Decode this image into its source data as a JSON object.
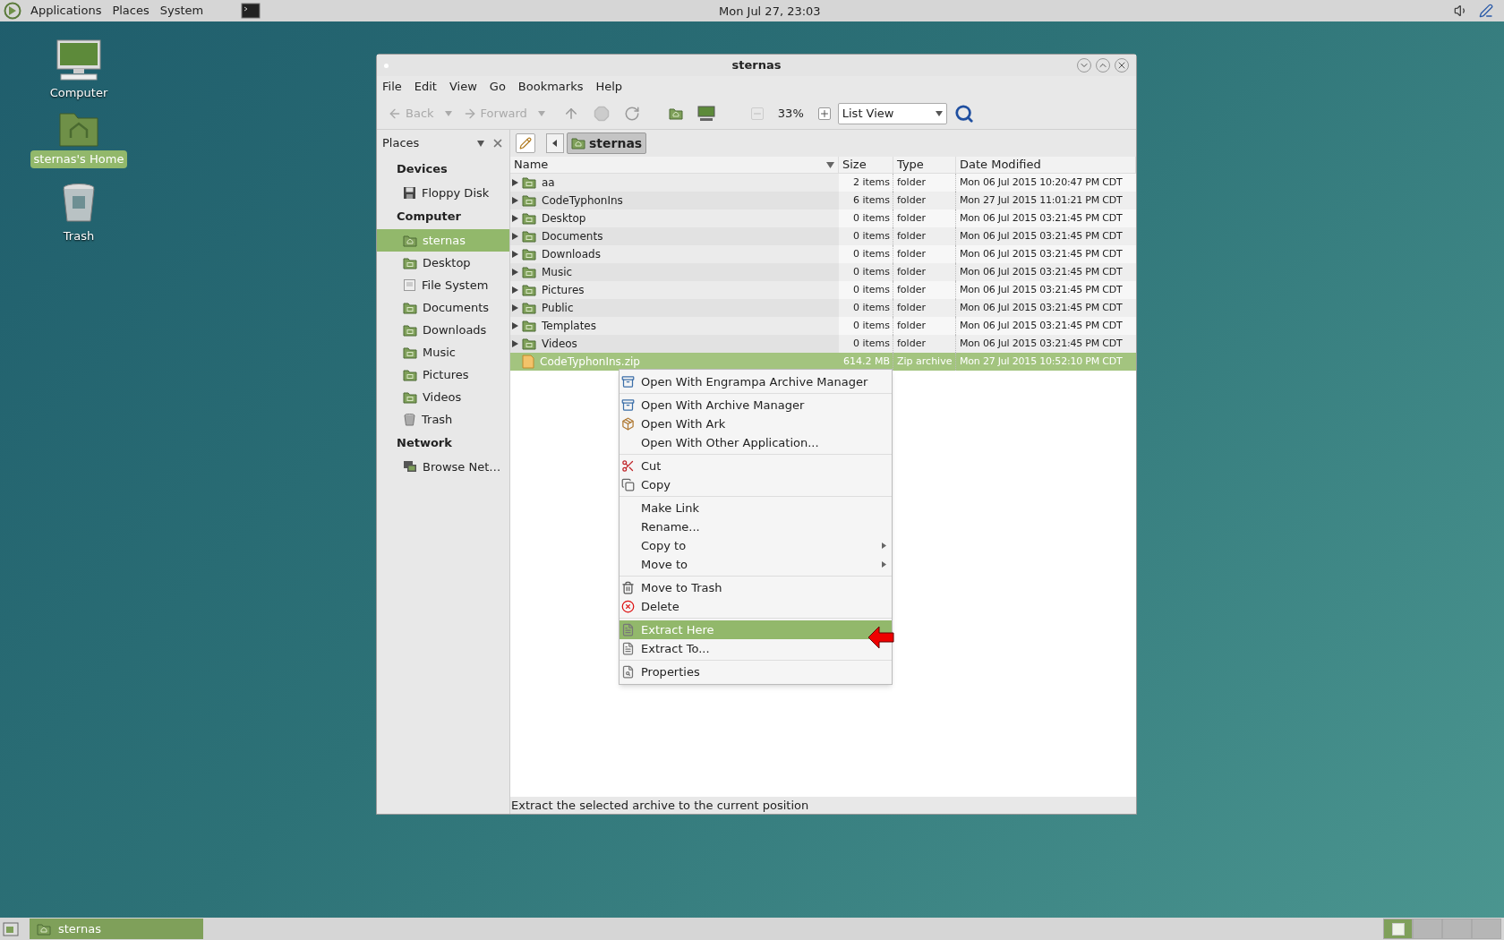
{
  "top_panel": {
    "menus": [
      "Applications",
      "Places",
      "System"
    ],
    "clock": "Mon Jul 27, 23:03"
  },
  "desktop_icons": [
    {
      "label": "Computer",
      "kind": "computer",
      "selected": false
    },
    {
      "label": "sternas's Home",
      "kind": "home",
      "selected": true
    },
    {
      "label": "Trash",
      "kind": "trash",
      "selected": false
    }
  ],
  "window": {
    "title": "sternas",
    "menu": [
      "File",
      "Edit",
      "View",
      "Go",
      "Bookmarks",
      "Help"
    ],
    "toolbar": {
      "back": {
        "label": "Back",
        "disabled": true
      },
      "forward": {
        "label": "Forward",
        "disabled": true
      },
      "zoom": "33%",
      "view": "List View"
    },
    "sidebar": {
      "title": "Places",
      "sections": [
        {
          "heading": "Devices",
          "items": [
            {
              "label": "Floppy Disk",
              "kind": "floppy",
              "selected": false
            }
          ]
        },
        {
          "heading": "Computer",
          "items": [
            {
              "label": "sternas",
              "kind": "home",
              "selected": true
            },
            {
              "label": "Desktop",
              "kind": "folder",
              "selected": false
            },
            {
              "label": "File System",
              "kind": "drive",
              "selected": false
            },
            {
              "label": "Documents",
              "kind": "folder",
              "selected": false
            },
            {
              "label": "Downloads",
              "kind": "folder",
              "selected": false
            },
            {
              "label": "Music",
              "kind": "folder",
              "selected": false
            },
            {
              "label": "Pictures",
              "kind": "folder",
              "selected": false
            },
            {
              "label": "Videos",
              "kind": "folder",
              "selected": false
            },
            {
              "label": "Trash",
              "kind": "trash",
              "selected": false
            }
          ]
        },
        {
          "heading": "Network",
          "items": [
            {
              "label": "Browse Net…",
              "kind": "network",
              "selected": false
            }
          ]
        }
      ]
    },
    "path": "sternas",
    "columns": [
      "Name",
      "Size",
      "Type",
      "Date Modified"
    ],
    "rows": [
      {
        "name": "aa",
        "size": "2 items",
        "type": "folder",
        "date": "Mon 06 Jul 2015 10:20:47 PM CDT",
        "kind": "folder",
        "selected": false
      },
      {
        "name": "CodeTyphonIns",
        "size": "6 items",
        "type": "folder",
        "date": "Mon 27 Jul 2015 11:01:21 PM CDT",
        "kind": "folder",
        "selected": false
      },
      {
        "name": "Desktop",
        "size": "0 items",
        "type": "folder",
        "date": "Mon 06 Jul 2015 03:21:45 PM CDT",
        "kind": "folder",
        "selected": false
      },
      {
        "name": "Documents",
        "size": "0 items",
        "type": "folder",
        "date": "Mon 06 Jul 2015 03:21:45 PM CDT",
        "kind": "folder",
        "selected": false
      },
      {
        "name": "Downloads",
        "size": "0 items",
        "type": "folder",
        "date": "Mon 06 Jul 2015 03:21:45 PM CDT",
        "kind": "folder",
        "selected": false
      },
      {
        "name": "Music",
        "size": "0 items",
        "type": "folder",
        "date": "Mon 06 Jul 2015 03:21:45 PM CDT",
        "kind": "folder",
        "selected": false
      },
      {
        "name": "Pictures",
        "size": "0 items",
        "type": "folder",
        "date": "Mon 06 Jul 2015 03:21:45 PM CDT",
        "kind": "folder",
        "selected": false
      },
      {
        "name": "Public",
        "size": "0 items",
        "type": "folder",
        "date": "Mon 06 Jul 2015 03:21:45 PM CDT",
        "kind": "folder",
        "selected": false
      },
      {
        "name": "Templates",
        "size": "0 items",
        "type": "folder",
        "date": "Mon 06 Jul 2015 03:21:45 PM CDT",
        "kind": "folder",
        "selected": false
      },
      {
        "name": "Videos",
        "size": "0 items",
        "type": "folder",
        "date": "Mon 06 Jul 2015 03:21:45 PM CDT",
        "kind": "folder",
        "selected": false
      },
      {
        "name": "CodeTyphonIns.zip",
        "size": "614.2 MB",
        "type": "Zip archive",
        "date": "Mon 27 Jul 2015 10:52:10 PM CDT",
        "kind": "file",
        "selected": true
      }
    ],
    "context_menu": [
      [
        {
          "label": "Open With Engrampa Archive Manager",
          "kind": "archive",
          "selected": false
        }
      ],
      [
        {
          "label": "Open With Archive Manager",
          "kind": "archive",
          "selected": false
        },
        {
          "label": "Open With Ark",
          "kind": "box",
          "selected": false
        },
        {
          "label": "Open With Other Application...",
          "selected": false
        }
      ],
      [
        {
          "label": "Cut",
          "kind": "cut",
          "selected": false
        },
        {
          "label": "Copy",
          "kind": "copy",
          "selected": false
        }
      ],
      [
        {
          "label": "Make Link",
          "selected": false
        },
        {
          "label": "Rename...",
          "selected": false
        },
        {
          "label": "Copy to",
          "submenu": true,
          "selected": false
        },
        {
          "label": "Move to",
          "submenu": true,
          "selected": false
        }
      ],
      [
        {
          "label": "Move to Trash",
          "kind": "trash",
          "selected": false
        },
        {
          "label": "Delete",
          "kind": "delete",
          "selected": false
        }
      ],
      [
        {
          "label": "Extract Here",
          "kind": "extract",
          "selected": true
        },
        {
          "label": "Extract To...",
          "kind": "extract",
          "selected": false
        }
      ],
      [
        {
          "label": "Properties",
          "kind": "properties",
          "selected": false
        }
      ]
    ],
    "status_bar": "Extract the selected archive to the current position"
  },
  "taskbar": {
    "items": [
      {
        "label": "sternas",
        "selected": true
      }
    ],
    "workspaces": [
      {
        "selected": true
      },
      {
        "selected": false
      },
      {
        "selected": false
      },
      {
        "selected": false
      }
    ]
  }
}
